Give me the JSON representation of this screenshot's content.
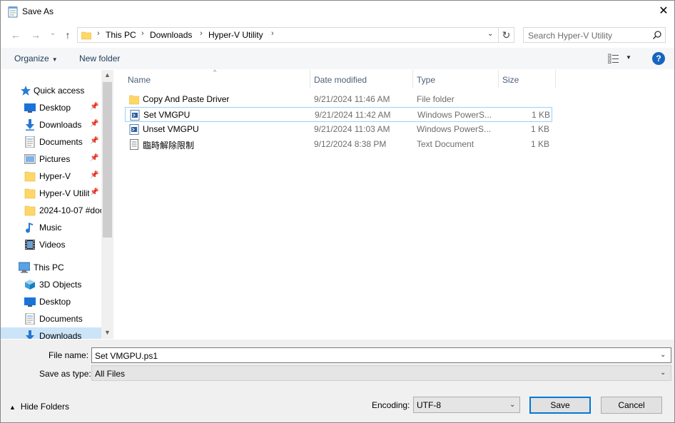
{
  "window": {
    "title": "Save As"
  },
  "nav": {
    "back": "←",
    "forward": "→",
    "recent": "⌄",
    "up": "↑",
    "breadcrumb": [
      "This PC",
      "Downloads",
      "Hyper-V Utility"
    ],
    "search_placeholder": "Search Hyper-V Utility"
  },
  "toolbar": {
    "organize": "Organize",
    "new_folder": "New folder",
    "help": "?"
  },
  "sidebar": {
    "items": [
      {
        "label": "Quick access",
        "icon": "star-icon",
        "pinned": false
      },
      {
        "label": "Desktop",
        "icon": "desktop-icon",
        "pinned": true
      },
      {
        "label": "Downloads",
        "icon": "download-icon",
        "pinned": true
      },
      {
        "label": "Documents",
        "icon": "document-icon",
        "pinned": true
      },
      {
        "label": "Pictures",
        "icon": "pictures-icon",
        "pinned": true
      },
      {
        "label": "Hyper-V",
        "icon": "folder-icon",
        "pinned": true
      },
      {
        "label": "Hyper-V Utilit",
        "icon": "folder-icon",
        "pinned": true
      },
      {
        "label": "2024-10-07 #doc",
        "icon": "folder-icon",
        "pinned": false
      },
      {
        "label": "Music",
        "icon": "music-icon",
        "pinned": false
      },
      {
        "label": "Videos",
        "icon": "video-icon",
        "pinned": false
      },
      {
        "label": "This PC",
        "icon": "computer-icon",
        "pinned": false
      },
      {
        "label": "3D Objects",
        "icon": "cube-icon",
        "pinned": false
      },
      {
        "label": "Desktop",
        "icon": "desktop-icon",
        "pinned": false
      },
      {
        "label": "Documents",
        "icon": "document-icon",
        "pinned": false
      },
      {
        "label": "Downloads",
        "icon": "download-icon",
        "pinned": false,
        "selected": true
      }
    ]
  },
  "columns": {
    "name": "Name",
    "date": "Date modified",
    "type": "Type",
    "size": "Size"
  },
  "files": [
    {
      "name": "Copy And Paste Driver",
      "date": "9/21/2024 11:46 AM",
      "type": "File folder",
      "size": "",
      "icon": "folder-icon"
    },
    {
      "name": "Set VMGPU",
      "date": "9/21/2024 11:42 AM",
      "type": "Windows PowerS...",
      "size": "1 KB",
      "icon": "powershell-script-icon"
    },
    {
      "name": "Unset VMGPU",
      "date": "9/21/2024 11:03 AM",
      "type": "Windows PowerS...",
      "size": "1 KB",
      "icon": "powershell-script-icon"
    },
    {
      "name": "臨時解除限制",
      "date": "9/12/2024 8:38 PM",
      "type": "Text Document",
      "size": "1 KB",
      "icon": "text-file-icon"
    }
  ],
  "form": {
    "file_name_label": "File name:",
    "file_name_value": "Set VMGPU.ps1",
    "save_type_label": "Save as type:",
    "save_type_value": "All Files",
    "encoding_label": "Encoding:",
    "encoding_value": "UTF-8",
    "save": "Save",
    "cancel": "Cancel",
    "hide_folders": "Hide Folders"
  }
}
